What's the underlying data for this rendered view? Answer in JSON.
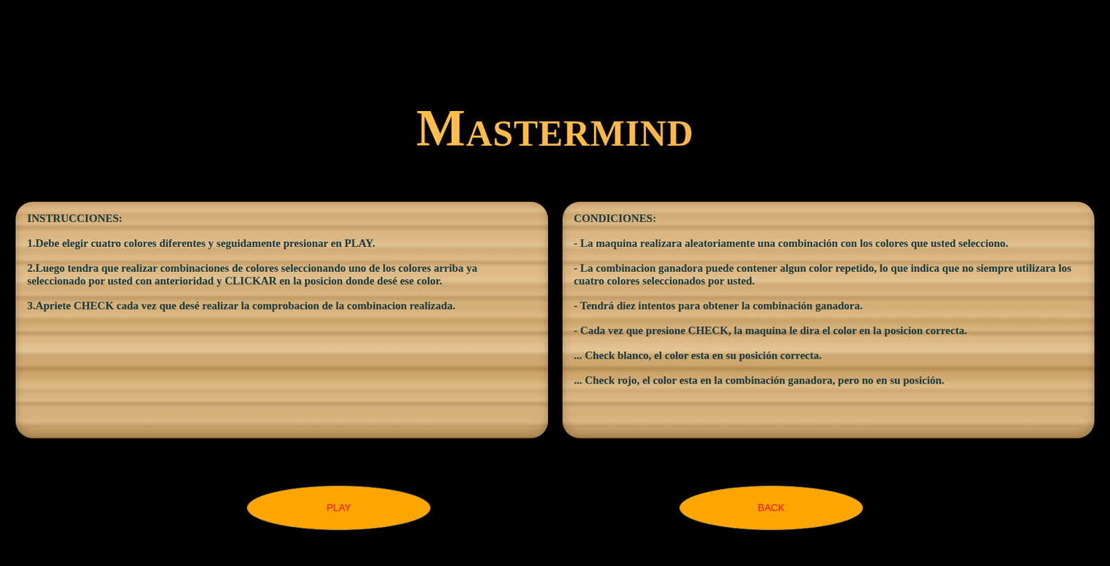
{
  "title": "Mastermind",
  "panels": [
    {
      "heading": "INSTRUCCIONES:",
      "lines": [
        "1.Debe elegir cuatro colores diferentes y seguidamente presionar en PLAY.",
        "2.Luego tendra que realizar combinaciones de colores seleccionando uno de los colores arriba ya seleccionado por usted con anterioridad y CLICKAR en la posicion donde desé ese color.",
        "3.Apriete CHECK cada vez que desé realizar la comprobacion de la combinacion realizada."
      ]
    },
    {
      "heading": "CONDICIONES:",
      "lines": [
        "- La maquina realizara aleatoriamente una combinación con los colores que usted selecciono.",
        "- La combinacion ganadora puede contener algun color repetido, lo que indica que no siempre utilizara los cuatro colores seleccionados por usted.",
        "- Tendrá diez intentos para obtener la combinación ganadora.",
        "- Cada vez que presione CHECK, la maquina le dira el color en la posicion correcta.",
        "... Check blanco, el color esta en su posición correcta.",
        "... Check rojo, el color esta en la combinación ganadora, pero no en su posición."
      ]
    }
  ],
  "buttons": [
    "PLAY",
    "BACK"
  ]
}
